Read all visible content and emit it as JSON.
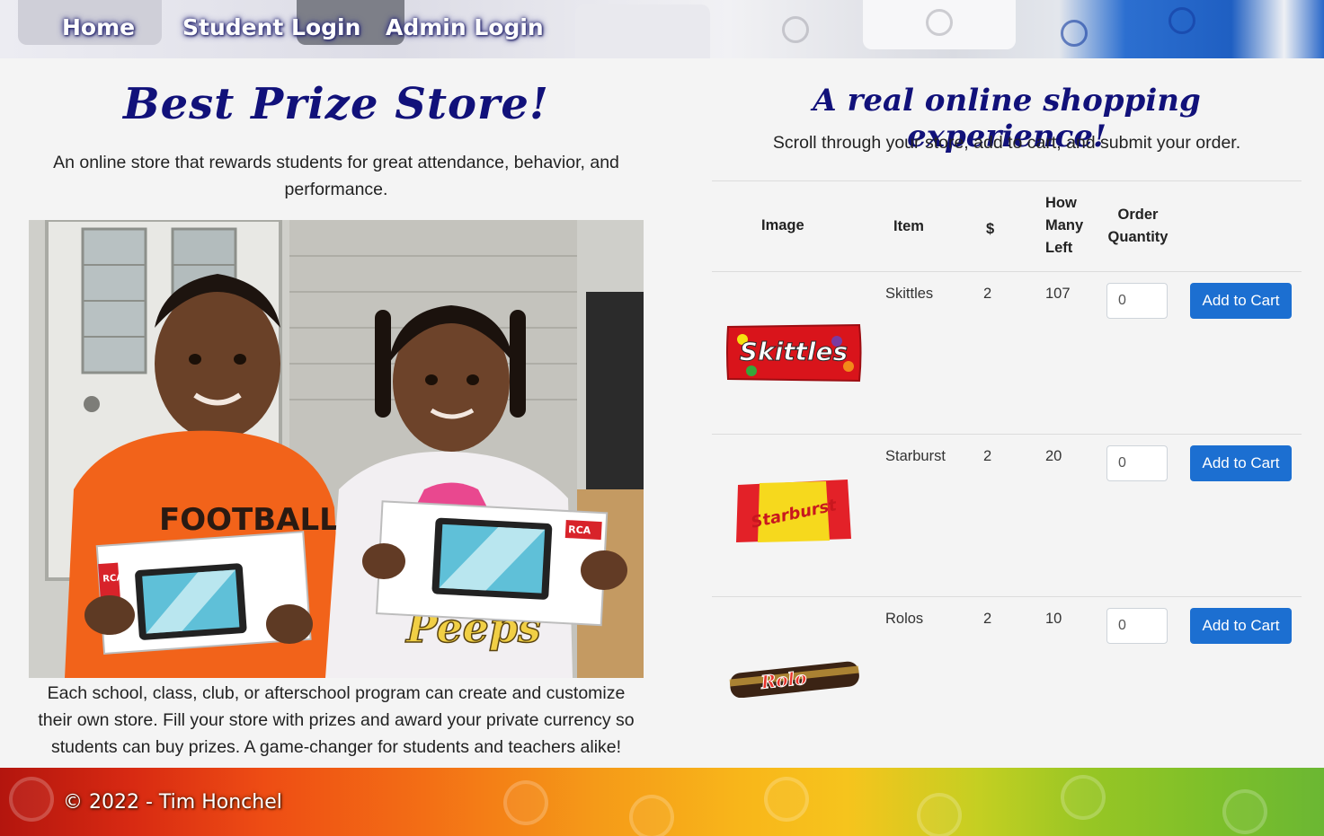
{
  "nav": {
    "links": [
      "Home",
      "Student Login",
      "Admin Login"
    ]
  },
  "left": {
    "title": "Best Prize Store!",
    "description": "An online store that rewards students for great attendance, behavior, and performance.",
    "footer_text": "Each school, class, club, or afterschool program can create and customize their own store. Fill your store with prizes and award your private currency so students can buy prizes. A game-changer for students and teachers alike!",
    "photo": {
      "shirt_text_left": "FOOTBALL",
      "shirt_text_right": "Peeps",
      "box_brand": "RCA"
    }
  },
  "right": {
    "title": "A real online shopping experience!",
    "description": "Scroll through your store, add to cart, and submit your order.",
    "table": {
      "headers": {
        "image": "Image",
        "item": "Item",
        "price": "$",
        "left_line1": "How",
        "left_line2": "Many",
        "left_line3": "Left",
        "order_line1": "Order",
        "order_line2": "Quantity"
      },
      "rows": [
        {
          "item": "Skittles",
          "price": "2",
          "left": "107",
          "qty": "0",
          "button": "Add to Cart",
          "wrapper_text": "Skittles"
        },
        {
          "item": "Starburst",
          "price": "2",
          "left": "20",
          "qty": "0",
          "button": "Add to Cart",
          "wrapper_text": "Starburst"
        },
        {
          "item": "Rolos",
          "price": "2",
          "left": "10",
          "qty": "0",
          "button": "Add to Cart",
          "wrapper_text": "Rolo"
        }
      ]
    }
  },
  "footer": {
    "text": "© 2022 - Tim Honchel"
  },
  "colors": {
    "title": "#11117a",
    "button": "#1c6fd1",
    "background": "#f4f4f4"
  }
}
